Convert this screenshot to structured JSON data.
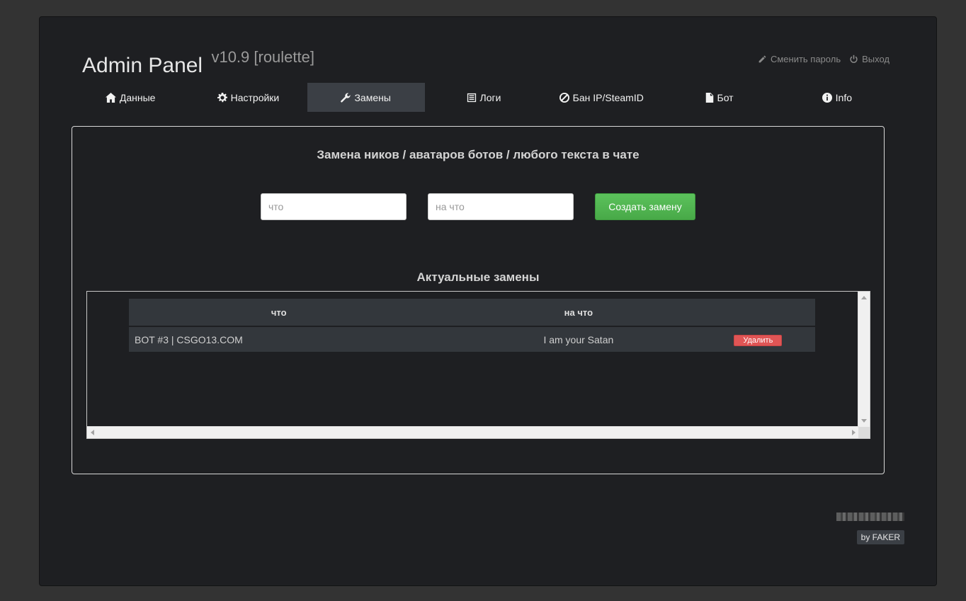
{
  "header": {
    "title": "Admin Panel",
    "version": "v10.9 [roulette]",
    "change_password": "Сменить пароль",
    "logout": "Выход"
  },
  "tabs": [
    {
      "label": "Данные",
      "icon": "home-icon"
    },
    {
      "label": "Настройки",
      "icon": "gear-icon"
    },
    {
      "label": "Замены",
      "icon": "wrench-icon",
      "active": true
    },
    {
      "label": "Логи",
      "icon": "list-icon"
    },
    {
      "label": "Бан IP/SteamID",
      "icon": "ban-icon"
    },
    {
      "label": "Бот",
      "icon": "file-icon"
    },
    {
      "label": "Info",
      "icon": "info-icon"
    }
  ],
  "replace_form": {
    "heading": "Замена ников / аватаров ботов / любого текста в чате",
    "from_placeholder": "что",
    "to_placeholder": "на что",
    "create_button": "Создать замену"
  },
  "current": {
    "heading": "Актуальные замены",
    "columns": [
      "что",
      "на что"
    ],
    "rows": [
      {
        "from": "BOT #3 | CSGO13.COM",
        "to": "I am your Satan",
        "delete_label": "Удалить"
      }
    ]
  },
  "footer": {
    "by": "by FAKER"
  },
  "colors": {
    "accent_green": "#5cb85c",
    "danger_red": "#e05555",
    "panel_bg": "#1e1f22"
  }
}
